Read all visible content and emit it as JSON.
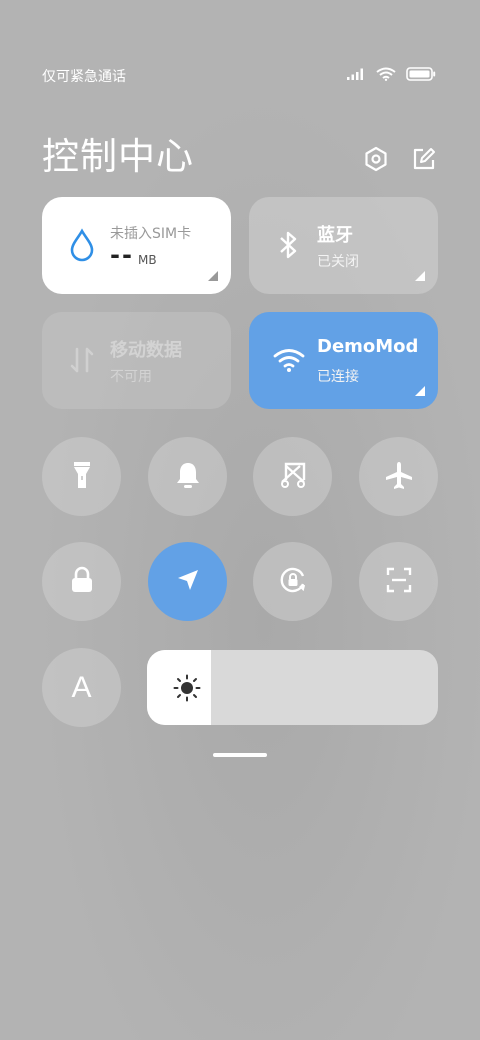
{
  "status_bar": {
    "carrier_text": "仅可紧急通话",
    "icons": [
      "signal-icon",
      "wifi-icon",
      "battery-icon"
    ]
  },
  "header": {
    "title": "控制中心",
    "icons": [
      "settings-icon",
      "edit-icon"
    ]
  },
  "tiles": {
    "sim": {
      "label": "未插入SIM卡",
      "value": "--",
      "unit": "MB",
      "icon": "water-drop-icon"
    },
    "bluetooth": {
      "label": "蓝牙",
      "status": "已关闭",
      "icon": "bluetooth-icon"
    },
    "mobile_data": {
      "label": "移动数据",
      "status": "不可用",
      "icon": "data-transfer-icon"
    },
    "wifi": {
      "label": "DemoMod",
      "status": "已连接",
      "icon": "wifi-icon"
    }
  },
  "toggles_row1": [
    "flashlight-icon",
    "bell-icon",
    "screenshot-icon",
    "airplane-icon"
  ],
  "toggles_row2": [
    "lock-icon",
    "location-icon",
    "rotation-lock-icon",
    "scan-icon"
  ],
  "font_button": {
    "label": "A"
  },
  "brightness": {
    "level": 0.22,
    "icon": "brightness-icon"
  },
  "colors": {
    "accent": "#62a1e6",
    "tile_white": "#ffffff",
    "background": "#b3b3b3"
  }
}
